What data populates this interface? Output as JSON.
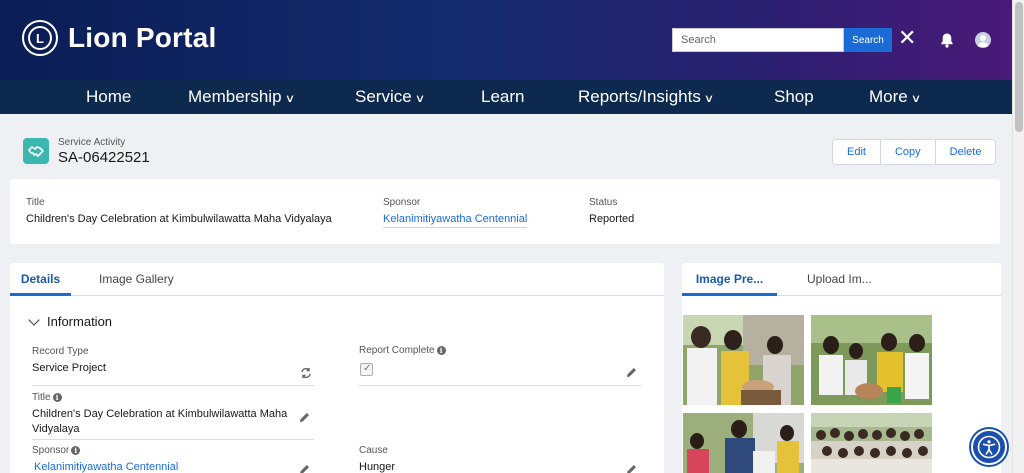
{
  "header": {
    "logo_mark": "L",
    "app_title": "Lion Portal",
    "search_placeholder": "Search",
    "search_button": "Search",
    "close_symbol": "✕"
  },
  "nav": {
    "items": [
      {
        "label": "Home",
        "has_dropdown": false
      },
      {
        "label": "Membership",
        "has_dropdown": true
      },
      {
        "label": "Service",
        "has_dropdown": true
      },
      {
        "label": "Learn",
        "has_dropdown": false
      },
      {
        "label": "Reports/Insights",
        "has_dropdown": true
      },
      {
        "label": "Shop",
        "has_dropdown": false
      },
      {
        "label": "More",
        "has_dropdown": true
      }
    ],
    "chevron": "∨"
  },
  "record": {
    "object_type": "Service Activity",
    "record_id": "SA-06422521",
    "actions": {
      "edit": "Edit",
      "copy": "Copy",
      "delete": "Delete"
    }
  },
  "highlights": {
    "title_label": "Title",
    "title_value": "Children's Day Celebration at Kimbulwilawatta Maha Vidyalaya",
    "sponsor_label": "Sponsor",
    "sponsor_value": "Kelanimitiyawatha Centennial",
    "status_label": "Status",
    "status_value": "Reported"
  },
  "details": {
    "tabs": {
      "details": "Details",
      "gallery": "Image Gallery"
    },
    "section_title": "Information",
    "fields": {
      "record_type_label": "Record Type",
      "record_type_value": "Service Project",
      "report_complete_label": "Report Complete",
      "title_label": "Title",
      "title_value_line1": "Children's Day Celebration at Kimbulwilawatta Maha",
      "title_value_line2": "Vidyalaya",
      "sponsor_label": "Sponsor",
      "sponsor_value": "Kelanimitiyawatha Centennial",
      "cause_label": "Cause",
      "cause_value": "Hunger"
    },
    "info_glyph": "i",
    "check_glyph": "✓"
  },
  "images": {
    "tabs": {
      "preview": "Image Pre...",
      "upload": "Upload Im..."
    }
  },
  "colors": {
    "brand_blue": "#1b6bd6",
    "nav_bg": "#0d2a4e",
    "record_icon": "#3bb7b0"
  }
}
